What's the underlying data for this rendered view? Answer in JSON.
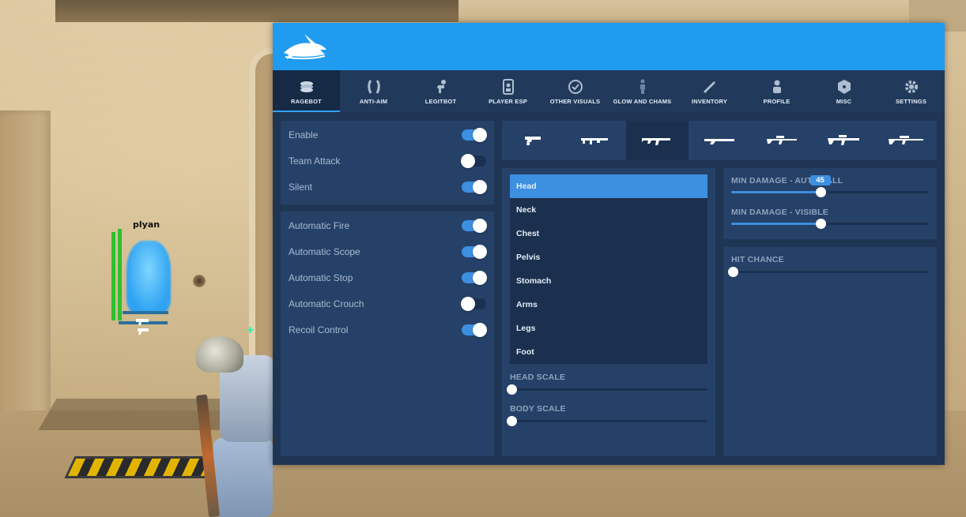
{
  "game": {
    "esp_name": "plyan"
  },
  "tabs": [
    {
      "label": "RAGEBOT",
      "icon": "ragebot-icon"
    },
    {
      "label": "ANTI-AIM",
      "icon": "anti-aim-icon"
    },
    {
      "label": "LEGITBOT",
      "icon": "legitbot-icon"
    },
    {
      "label": "PLAYER ESP",
      "icon": "player-esp-icon"
    },
    {
      "label": "OTHER VISUALS",
      "icon": "other-visuals-icon"
    },
    {
      "label": "GLOW AND CHAMS",
      "icon": "glow-chams-icon"
    },
    {
      "label": "INVENTORY",
      "icon": "inventory-icon"
    },
    {
      "label": "PROFILE",
      "icon": "profile-icon"
    },
    {
      "label": "MISC",
      "icon": "misc-icon"
    },
    {
      "label": "SETTINGS",
      "icon": "settings-icon"
    }
  ],
  "active_tab": "RAGEBOT",
  "general": [
    {
      "label": "Enable",
      "on": true
    },
    {
      "label": "Team Attack",
      "on": false
    },
    {
      "label": "Silent",
      "on": true
    }
  ],
  "fire": [
    {
      "label": "Automatic Fire",
      "on": true
    },
    {
      "label": "Automatic Scope",
      "on": true
    },
    {
      "label": "Automatic Stop",
      "on": true
    },
    {
      "label": "Automatic Crouch",
      "on": false
    },
    {
      "label": "Recoil Control",
      "on": true
    }
  ],
  "weapons": [
    {
      "icon": "pistol-icon"
    },
    {
      "icon": "smg-icon"
    },
    {
      "icon": "rifle-icon",
      "active": true
    },
    {
      "icon": "shotgun-icon"
    },
    {
      "icon": "scout-icon"
    },
    {
      "icon": "auto-sniper-icon"
    },
    {
      "icon": "awp-icon"
    }
  ],
  "hitboxes": [
    "Head",
    "Neck",
    "Chest",
    "Pelvis",
    "Stomach",
    "Arms",
    "Legs",
    "Foot"
  ],
  "active_hitbox": "Head",
  "sliders": {
    "head_scale": {
      "label": "HEAD SCALE",
      "value": 0
    },
    "body_scale": {
      "label": "BODY SCALE",
      "value": 0
    },
    "min_damage_autowall": {
      "label": "MIN DAMAGE - AUTOWALL",
      "value": 45,
      "fraction": 0.45
    },
    "min_damage_visible": {
      "label": "MIN DAMAGE - VISIBLE",
      "fraction": 0.45
    },
    "hit_chance": {
      "label": "HIT CHANCE",
      "fraction": 0
    }
  },
  "colors": {
    "header": "#1f9bf0",
    "accent": "#3d8fe0",
    "panel": "#254168",
    "background": "#1f3554"
  }
}
